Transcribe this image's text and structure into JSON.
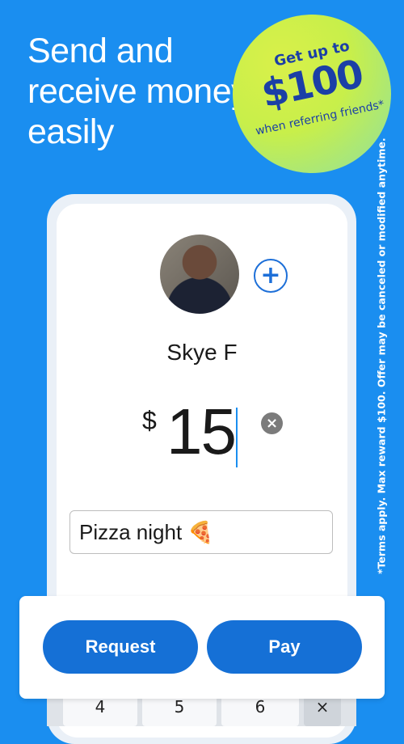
{
  "headline": "Send and receive money easily",
  "promo": {
    "line1": "Get up to",
    "amount": "$100",
    "line3": "when referring friends*"
  },
  "terms": "*Terms apply. Max reward $100. Offer may be canceled or modified anytime.",
  "contact": {
    "name": "Skye F"
  },
  "payment": {
    "currency": "$",
    "amount": "15",
    "note": "Pizza night 🍕"
  },
  "actions": {
    "request_label": "Request",
    "pay_label": "Pay"
  },
  "keypad": {
    "keys": [
      "4",
      "5",
      "6",
      "×"
    ]
  }
}
